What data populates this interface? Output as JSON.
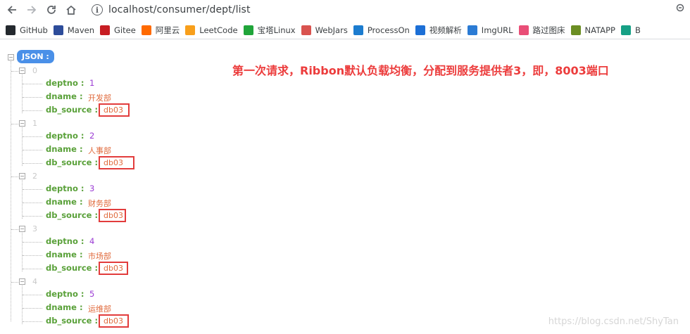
{
  "browser": {
    "url": "localhost/consumer/dept/list",
    "bookmarks": [
      {
        "label": "GitHub",
        "icon": "github-icon",
        "color": "#24292e"
      },
      {
        "label": "Maven",
        "icon": "maven-icon",
        "color": "#2d4c9a"
      },
      {
        "label": "Gitee",
        "icon": "gitee-icon",
        "color": "#c71d23"
      },
      {
        "label": "阿里云",
        "icon": "aliyun-icon",
        "color": "#ff6a00"
      },
      {
        "label": "LeetCode",
        "icon": "leetcode-icon",
        "color": "#f89f1b"
      },
      {
        "label": "宝塔Linux",
        "icon": "bt-icon",
        "color": "#20a53a"
      },
      {
        "label": "WebJars",
        "icon": "webjars-icon",
        "color": "#d9534f"
      },
      {
        "label": "ProcessOn",
        "icon": "processon-icon",
        "color": "#1c7ccf"
      },
      {
        "label": "视频解析",
        "icon": "video-icon",
        "color": "#1c6fd6"
      },
      {
        "label": "ImgURL",
        "icon": "imgurl-icon",
        "color": "#2b7bd4"
      },
      {
        "label": "路过图床",
        "icon": "luguo-icon",
        "color": "#e94e77"
      },
      {
        "label": "NATAPP",
        "icon": "natapp-icon",
        "color": "#6b8e23"
      },
      {
        "label": "B",
        "icon": "b-icon",
        "color": "#16a085"
      }
    ]
  },
  "json_view": {
    "badge": "JSON :",
    "items": [
      {
        "index": "0",
        "deptno": "1",
        "dname": "开发部",
        "db_source": "db03"
      },
      {
        "index": "1",
        "deptno": "2",
        "dname": "人事部",
        "db_source": "db03"
      },
      {
        "index": "2",
        "deptno": "3",
        "dname": "财务部",
        "db_source": "db03"
      },
      {
        "index": "3",
        "deptno": "4",
        "dname": "市场部",
        "db_source": "db03"
      },
      {
        "index": "4",
        "deptno": "5",
        "dname": "运维部",
        "db_source": "db03"
      }
    ],
    "keys": {
      "deptno": "deptno :",
      "dname": "dname :",
      "db_source": "db_source :"
    }
  },
  "annotation": "第一次请求，Ribbon默认负载均衡，分配到服务提供者3，即，8003端口",
  "watermark": "https://blog.csdn.net/ShyTan",
  "colors": {
    "highlight": "#e23c3c",
    "annotation": "#ec3c3c",
    "key": "#5aa13a",
    "number": "#9b3cd4",
    "string": "#e06a3c"
  }
}
